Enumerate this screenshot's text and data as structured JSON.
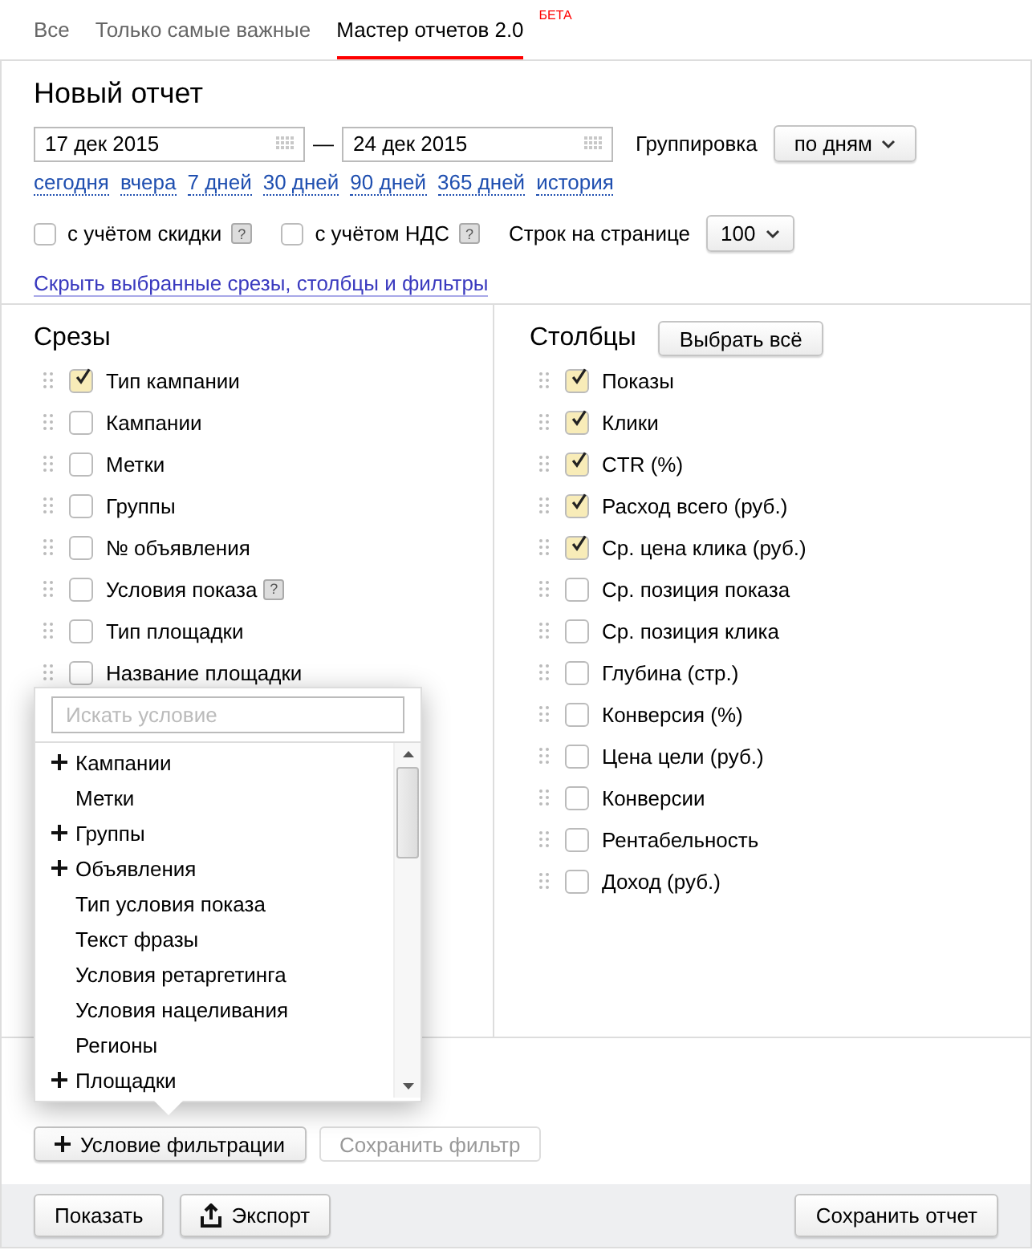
{
  "tabs": [
    {
      "label": "Все",
      "selected": false
    },
    {
      "label": "Только самые важные",
      "selected": false
    },
    {
      "label": "Мастер отчетов 2.0",
      "badge": "БЕТА",
      "selected": true
    }
  ],
  "report": {
    "title": "Новый отчет",
    "date_from": "17 дек 2015",
    "date_separator": "—",
    "date_to": "24 дек 2015",
    "grouping_label": "Группировка",
    "grouping_value": "по дням",
    "quick_periods": [
      "сегодня",
      "вчера",
      "7 дней",
      "30 дней",
      "90 дней",
      "365 дней",
      "история"
    ],
    "options": [
      {
        "label": "с учётом скидки",
        "checked": false,
        "help": "?"
      },
      {
        "label": "с учётом НДС",
        "checked": false,
        "help": "?"
      }
    ],
    "rows_label": "Строк на странице",
    "rows_value": "100",
    "toggle_link": "Скрыть выбранные срезы, столбцы и фильтры"
  },
  "slices": {
    "title": "Срезы",
    "items": [
      {
        "label": "Тип кампании",
        "checked": true
      },
      {
        "label": "Кампании",
        "checked": false
      },
      {
        "label": "Метки",
        "checked": false
      },
      {
        "label": "Группы",
        "checked": false
      },
      {
        "label": "№ объявления",
        "checked": false
      },
      {
        "label": "Условия показа",
        "checked": false,
        "help": "?"
      },
      {
        "label": "Тип площадки",
        "checked": false
      },
      {
        "label": "Название площадки",
        "checked": false
      }
    ]
  },
  "columns": {
    "title": "Столбцы",
    "select_all": "Выбрать всё",
    "items": [
      {
        "label": "Показы",
        "checked": true
      },
      {
        "label": "Клики",
        "checked": true
      },
      {
        "label": "CTR (%)",
        "checked": true
      },
      {
        "label": "Расход всего (руб.)",
        "checked": true
      },
      {
        "label": "Ср. цена клика (руб.)",
        "checked": true
      },
      {
        "label": "Ср. позиция показа",
        "checked": false
      },
      {
        "label": "Ср. позиция клика",
        "checked": false
      },
      {
        "label": "Глубина (стр.)",
        "checked": false
      },
      {
        "label": "Конверсия (%)",
        "checked": false
      },
      {
        "label": "Цена цели (руб.)",
        "checked": false
      },
      {
        "label": "Конверсии",
        "checked": false
      },
      {
        "label": "Рентабельность",
        "checked": false
      },
      {
        "label": "Доход (руб.)",
        "checked": false
      }
    ]
  },
  "condition_popup": {
    "search_placeholder": "Искать условие",
    "items": [
      {
        "label": "Кампании",
        "expandable": true
      },
      {
        "label": "Метки",
        "expandable": false
      },
      {
        "label": "Группы",
        "expandable": true
      },
      {
        "label": "Объявления",
        "expandable": true
      },
      {
        "label": "Тип условия показа",
        "expandable": false
      },
      {
        "label": "Текст фразы",
        "expandable": false
      },
      {
        "label": "Условия ретаргетинга",
        "expandable": false
      },
      {
        "label": "Условия нацеливания",
        "expandable": false
      },
      {
        "label": "Регионы",
        "expandable": false
      },
      {
        "label": "Площадки",
        "expandable": true
      }
    ]
  },
  "filter_buttons": [
    {
      "label": "Условие фильтрации",
      "disabled": false
    },
    {
      "label": "Сохранить фильтр",
      "disabled": true
    }
  ],
  "footer": {
    "buttons": [
      {
        "label": "Показать"
      },
      {
        "label": "Экспорт"
      }
    ],
    "save": "Сохранить отчет"
  }
}
